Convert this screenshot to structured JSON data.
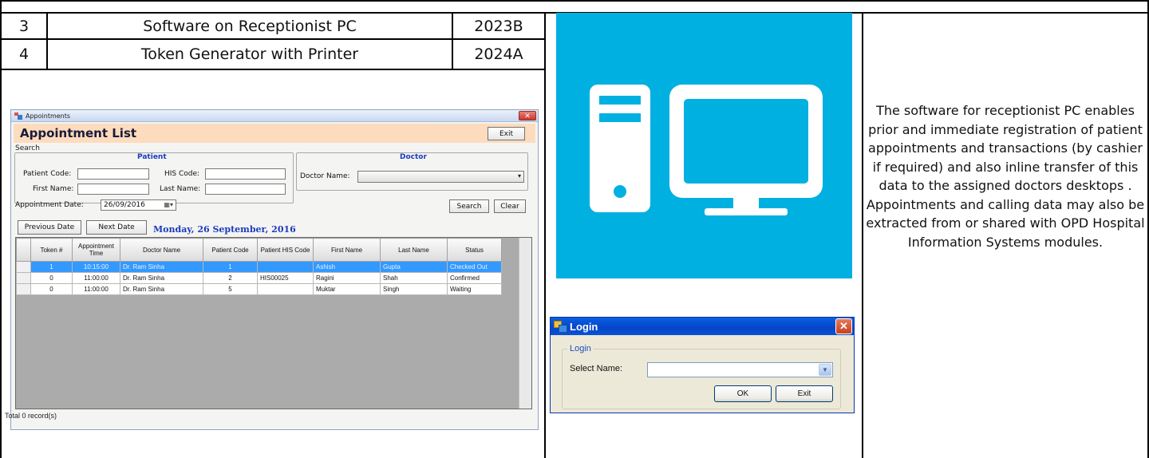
{
  "table_rows": [
    {
      "no": "3",
      "item": "Software on Receptionist PC",
      "version": "2023B"
    },
    {
      "no": "4",
      "item": "Token Generator with Printer",
      "version": "2024A"
    }
  ],
  "appointments_window": {
    "title": "Appointments",
    "close_glyph": "✕",
    "header_title": "Appointment List",
    "exit_label": "Exit",
    "search_label": "Search",
    "patient_group_title": "Patient",
    "doctor_group_title": "Doctor",
    "patient_code_label": "Patient Code:",
    "his_code_label": "HIS Code:",
    "first_name_label": "First Name:",
    "last_name_label": "Last Name:",
    "doctor_name_label": "Doctor Name:",
    "appointment_date_label": "Appointment Date:",
    "appointment_date_value": "26/09/2016",
    "search_button": "Search",
    "clear_button": "Clear",
    "previous_date_button": "Previous Date",
    "next_date_button": "Next Date",
    "day_label": "Monday, 26 September, 2016",
    "columns": [
      "Token #",
      "Appointment Time",
      "Doctor Name",
      "Patient Code",
      "Patient HIS Code",
      "First Name",
      "Last Name",
      "Status"
    ],
    "rows": [
      {
        "token": "1",
        "time": "10:15:00",
        "doctor": "Dr. Ram Sinha",
        "patient_code": "1",
        "his_code": "",
        "first_name": "Ashish",
        "last_name": "Gupta",
        "status": "Checked Out"
      },
      {
        "token": "0",
        "time": "11:00:00",
        "doctor": "Dr. Ram Sinha",
        "patient_code": "2",
        "his_code": "HIS00025",
        "first_name": "Ragini",
        "last_name": "Shah",
        "status": "Confirmed"
      },
      {
        "token": "0",
        "time": "11:00:00",
        "doctor": "Dr. Ram Sinha",
        "patient_code": "5",
        "his_code": "",
        "first_name": "Muktar",
        "last_name": "Singh",
        "status": "Waiting"
      }
    ],
    "footer": "Total 0 record(s)"
  },
  "illustration": {
    "icon": "desktop-computer-icon",
    "background": "#00b0e0"
  },
  "login_window": {
    "title": "Login",
    "close_glyph": "✕",
    "group_title": "Login",
    "select_name_label": "Select Name:",
    "select_name_value": "",
    "ok_button": "OK",
    "exit_button": "Exit"
  },
  "description": "The software for receptionist PC enables prior and immediate registration of patient appointments and transactions (by cashier if required) and also inline transfer of this data to the assigned doctors desktops . Appointments and calling  data may also be extracted from or shared with OPD Hospital Information Systems modules."
}
